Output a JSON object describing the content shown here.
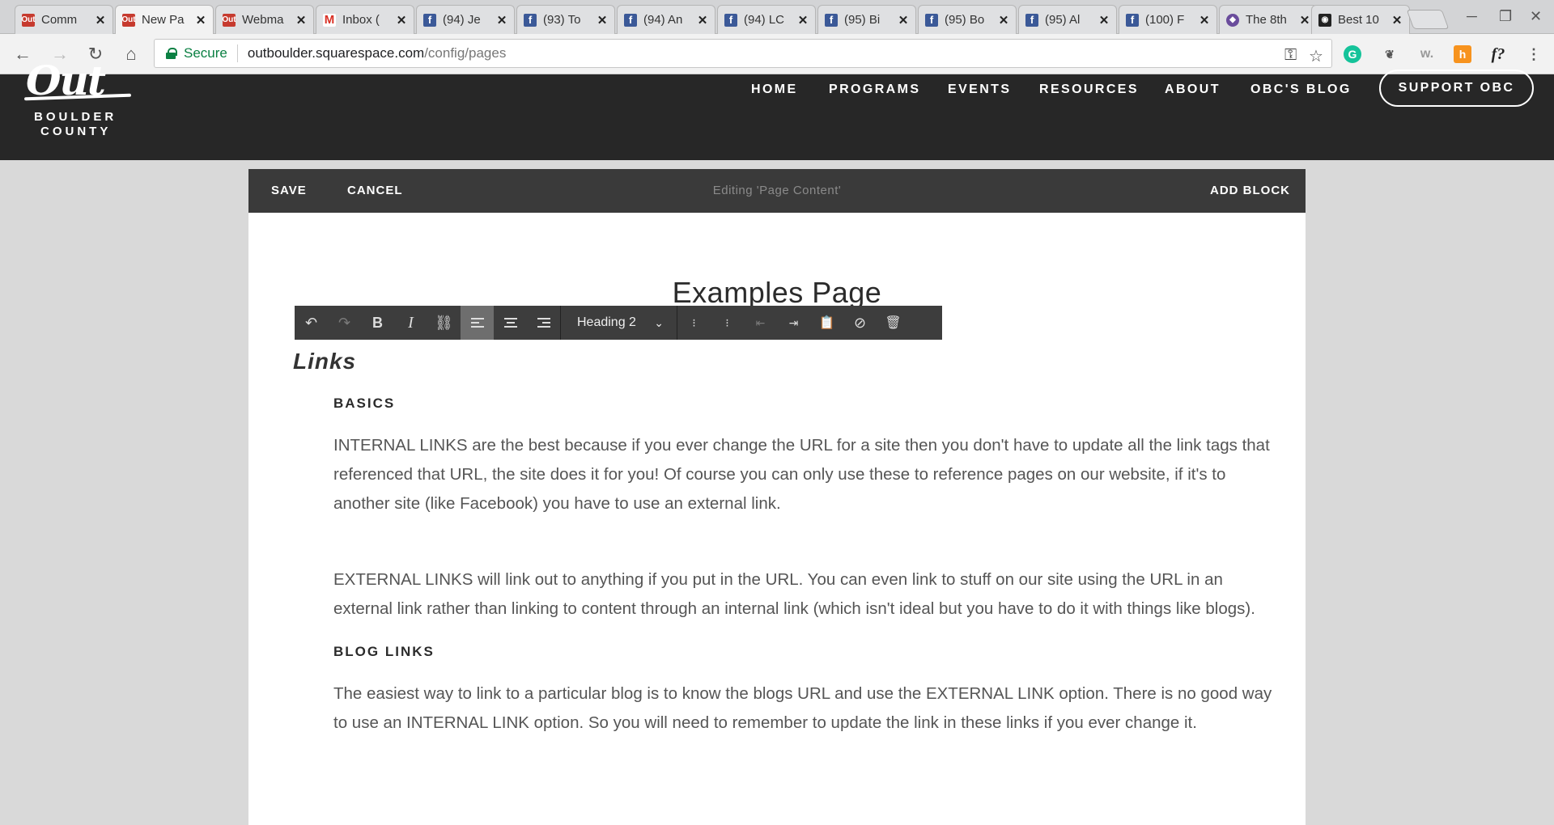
{
  "browser": {
    "tabs": [
      {
        "title": "Comm",
        "favicon": "out-logo-icon"
      },
      {
        "title": "New Pa",
        "favicon": "out-logo-icon",
        "active": true
      },
      {
        "title": "Webma",
        "favicon": "out-logo-icon"
      },
      {
        "title": "Inbox (",
        "favicon": "gmail-icon"
      },
      {
        "title": "(94) Je",
        "favicon": "facebook-icon"
      },
      {
        "title": "(93) To",
        "favicon": "facebook-icon"
      },
      {
        "title": "(94) An",
        "favicon": "facebook-icon"
      },
      {
        "title": "(94) LC",
        "favicon": "facebook-icon"
      },
      {
        "title": "(95) Bi",
        "favicon": "facebook-icon"
      },
      {
        "title": "(95) Bo",
        "favicon": "facebook-icon"
      },
      {
        "title": "(95) Al",
        "favicon": "facebook-icon"
      },
      {
        "title": "(100) F",
        "favicon": "facebook-icon"
      },
      {
        "title": "The 8th",
        "favicon": "the8th-icon"
      },
      {
        "title": "Best 10",
        "favicon": "camera-icon"
      }
    ],
    "address": {
      "secure_label": "Secure",
      "host": "outboulder.squarespace.com",
      "path": "/config/pages"
    }
  },
  "site": {
    "logo": {
      "script": "Out",
      "line1": "BOULDER",
      "line2": "COUNTY"
    },
    "nav": [
      "HOME",
      "PROGRAMS",
      "EVENTS",
      "RESOURCES",
      "ABOUT",
      "OBC'S BLOG"
    ],
    "cta": "SUPPORT OBC"
  },
  "editor": {
    "save": "SAVE",
    "cancel": "CANCEL",
    "status": "Editing 'Page Content'",
    "add_block": "ADD BLOCK",
    "format_select": "Heading 2"
  },
  "content": {
    "page_title": "Examples Page",
    "heading": "Links",
    "sections": [
      {
        "title": "BASICS",
        "paragraphs": [
          "INTERNAL LINKS are the best because if you ever change the URL for a site then you don't have to update all the link tags that referenced that URL, the site does it for you! Of course you can only use these to reference pages on our website, if it's to another site (like Facebook) you have to use an external link.",
          "EXTERNAL LINKS will link out to anything if you put in the URL. You can even link to stuff on our site using the URL in an external link rather than linking to content through an internal link (which isn't ideal but you have to do it with things like blogs)."
        ]
      },
      {
        "title": "BLOG LINKS",
        "paragraphs": [
          "The easiest way to link to a particular blog is to know the blogs URL and use the EXTERNAL LINK option. There is no good way to use an INTERNAL LINK option. So you will need to remember to update the link in these links if you ever change it."
        ]
      }
    ]
  }
}
